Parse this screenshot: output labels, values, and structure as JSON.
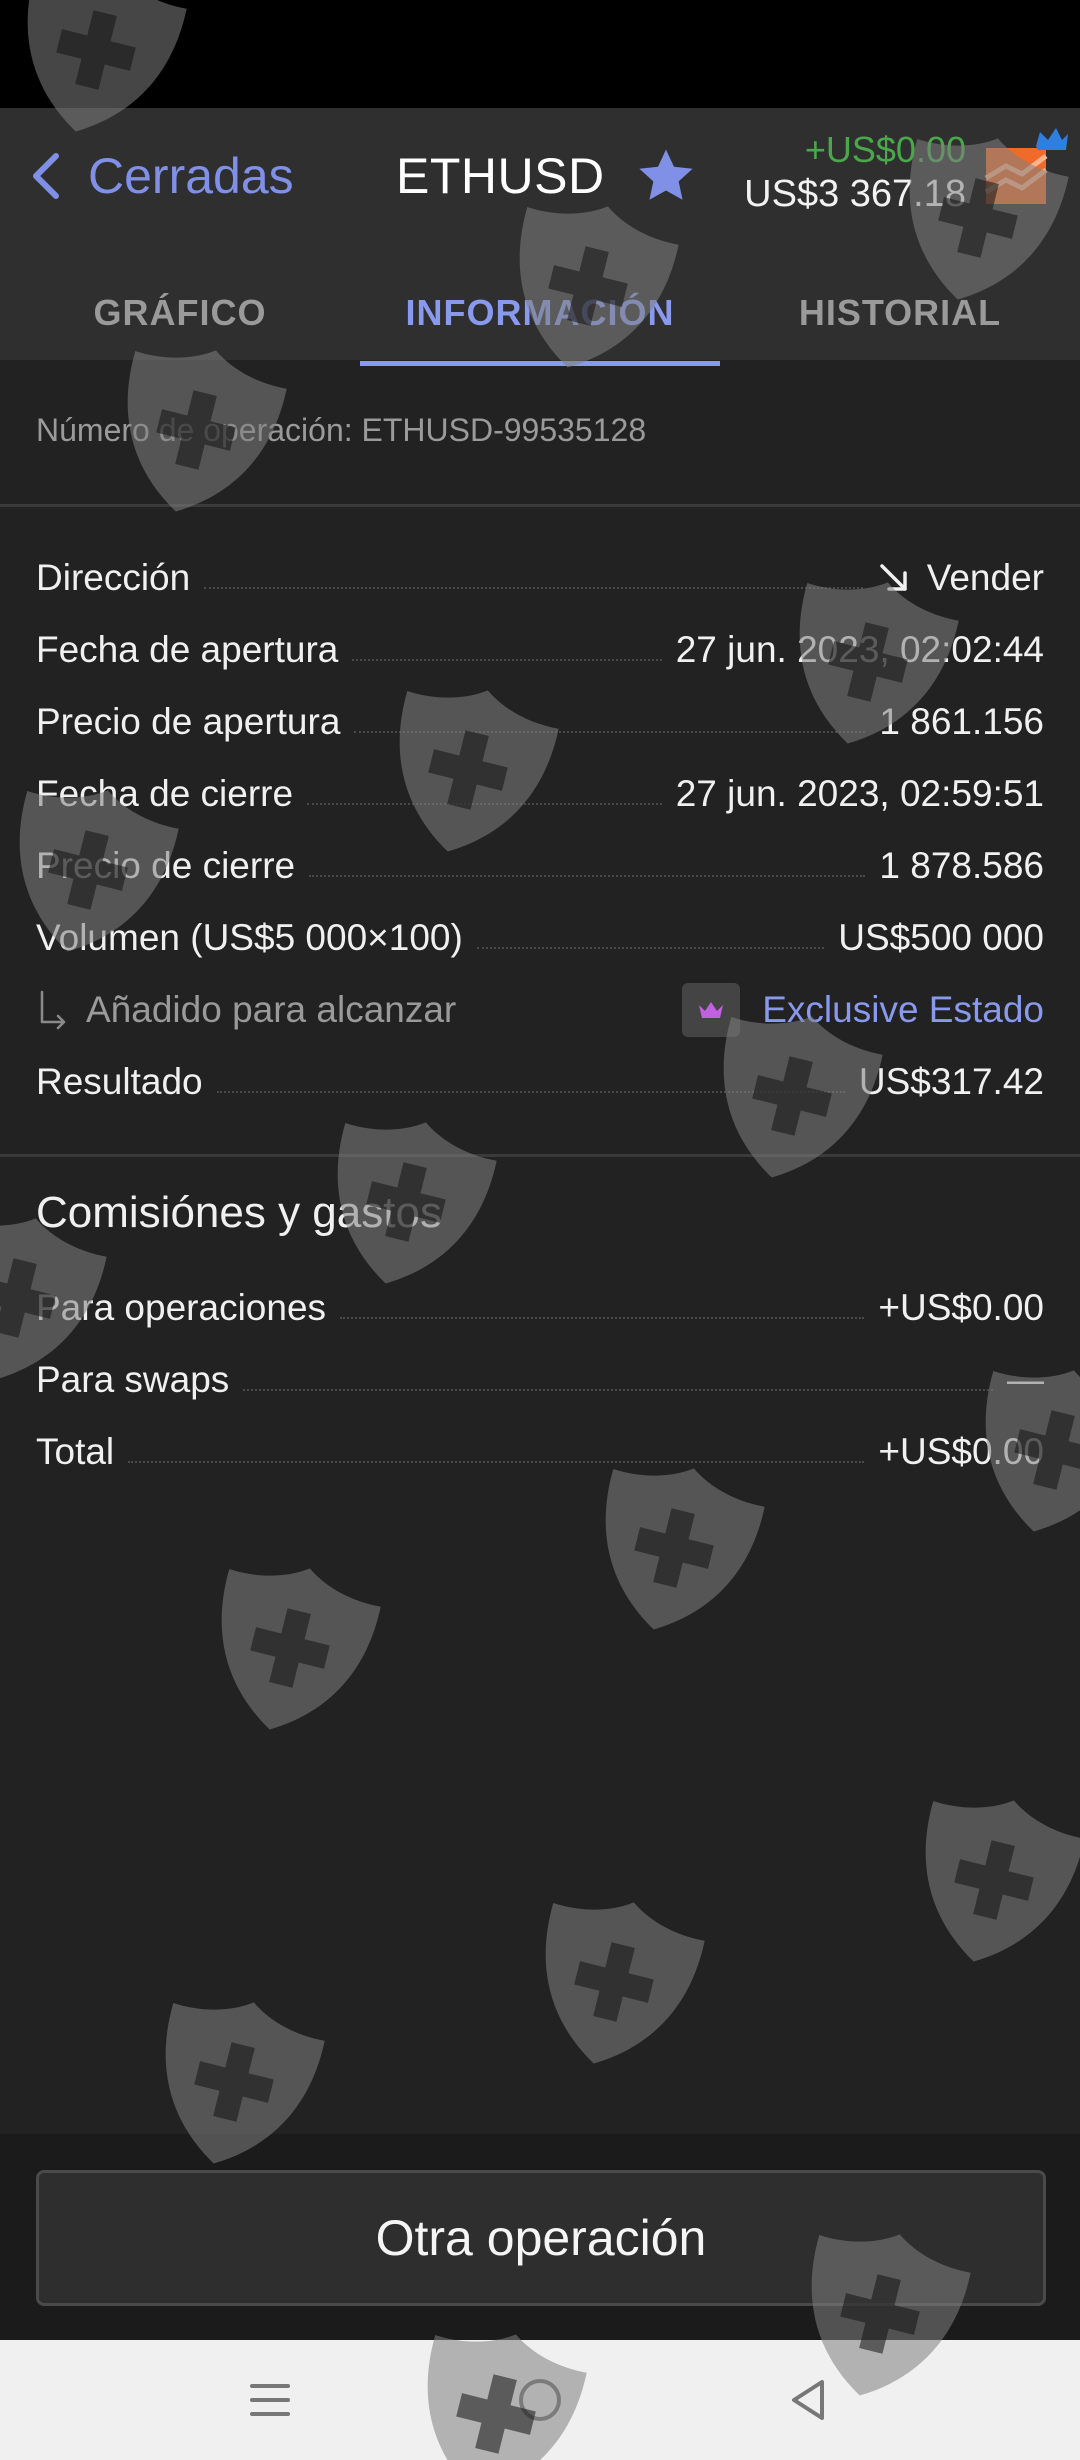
{
  "header": {
    "back_label": "Cerradas",
    "symbol": "ETHUSD",
    "pnl": "+US$0.00",
    "equity": "US$3 367.18"
  },
  "tabs": [
    {
      "label": "GRÁFICO",
      "active": false
    },
    {
      "label": "INFORMACIÓN",
      "active": true
    },
    {
      "label": "HISTORIAL",
      "active": false
    }
  ],
  "operation_number": "Número de operación: ETHUSD-99535128",
  "details": {
    "direccion": {
      "label": "Dirección",
      "value": "Vender"
    },
    "fecha_apertura": {
      "label": "Fecha de apertura",
      "value": "27 jun. 2023, 02:02:44"
    },
    "precio_apertura": {
      "label": "Precio de apertura",
      "value": "1 861.156"
    },
    "fecha_cierre": {
      "label": "Fecha de cierre",
      "value": "27 jun. 2023, 02:59:51"
    },
    "precio_cierre": {
      "label": "Precio de cierre",
      "value": "1 878.586"
    },
    "volumen": {
      "label": "Volumen (US$5 000×100)",
      "value": "US$500 000"
    },
    "anadido": {
      "label": "Añadido para alcanzar",
      "value": "Exclusive Estado"
    },
    "resultado": {
      "label": "Resultado",
      "value": "US$317.42"
    }
  },
  "fees": {
    "title": "Comisiónes y gastos",
    "operaciones": {
      "label": "Para operaciones",
      "value": "+US$0.00"
    },
    "swaps": {
      "label": "Para swaps",
      "value": "—"
    },
    "total": {
      "label": "Total",
      "value": "+US$0.00"
    }
  },
  "action_button": "Otra operación",
  "colors": {
    "accent": "#8899ee",
    "positive": "#48a84a",
    "background": "#222222",
    "header": "#2f2f2f",
    "account_icon": "#f06a2a"
  },
  "icons": [
    "chevron-left-icon",
    "star-icon",
    "account-chart-icon",
    "crown-icon",
    "arrow-down-right-icon",
    "corner-down-right-icon",
    "menu-icon",
    "home-circle-icon",
    "back-triangle-icon",
    "shield-watermark-icon"
  ]
}
